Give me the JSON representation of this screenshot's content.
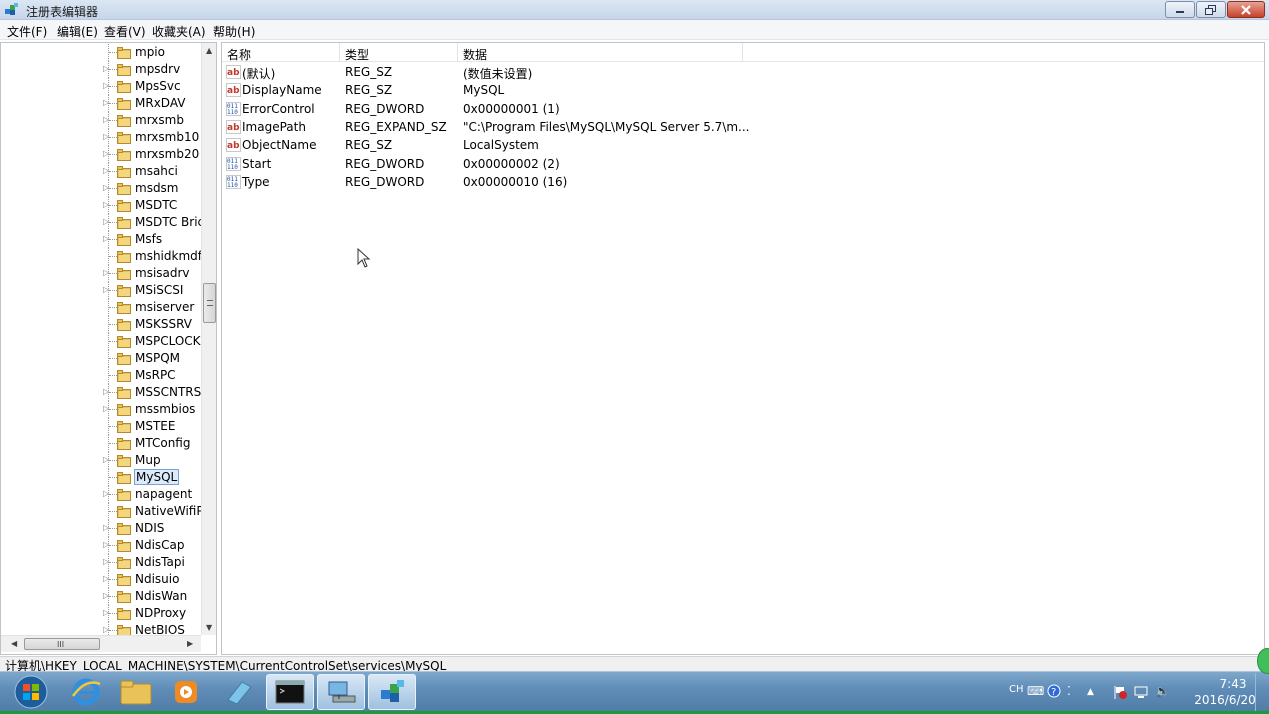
{
  "window": {
    "title": "注册表编辑器"
  },
  "menu": [
    "文件(F)",
    "编辑(E)",
    "查看(V)",
    "收藏夹(A)",
    "帮助(H)"
  ],
  "tree": {
    "items": [
      {
        "label": "mpio",
        "expandable": false
      },
      {
        "label": "mpsdrv",
        "expandable": true
      },
      {
        "label": "MpsSvc",
        "expandable": true
      },
      {
        "label": "MRxDAV",
        "expandable": true
      },
      {
        "label": "mrxsmb",
        "expandable": true
      },
      {
        "label": "mrxsmb10",
        "expandable": true
      },
      {
        "label": "mrxsmb20",
        "expandable": true
      },
      {
        "label": "msahci",
        "expandable": true
      },
      {
        "label": "msdsm",
        "expandable": true
      },
      {
        "label": "MSDTC",
        "expandable": true
      },
      {
        "label": "MSDTC Bric",
        "expandable": true
      },
      {
        "label": "Msfs",
        "expandable": true
      },
      {
        "label": "mshidkmdf",
        "expandable": false
      },
      {
        "label": "msisadrv",
        "expandable": true
      },
      {
        "label": "MSiSCSI",
        "expandable": true
      },
      {
        "label": "msiserver",
        "expandable": false
      },
      {
        "label": "MSKSSRV",
        "expandable": false
      },
      {
        "label": "MSPCLOCK",
        "expandable": false
      },
      {
        "label": "MSPQM",
        "expandable": false
      },
      {
        "label": "MsRPC",
        "expandable": false
      },
      {
        "label": "MSSCNTRS",
        "expandable": true
      },
      {
        "label": "mssmbios",
        "expandable": true
      },
      {
        "label": "MSTEE",
        "expandable": false
      },
      {
        "label": "MTConfig",
        "expandable": false
      },
      {
        "label": "Mup",
        "expandable": true
      },
      {
        "label": "MySQL",
        "expandable": false,
        "selected": true
      },
      {
        "label": "napagent",
        "expandable": true
      },
      {
        "label": "NativeWifiP",
        "expandable": false
      },
      {
        "label": "NDIS",
        "expandable": true
      },
      {
        "label": "NdisCap",
        "expandable": true
      },
      {
        "label": "NdisTapi",
        "expandable": true
      },
      {
        "label": "Ndisuio",
        "expandable": true
      },
      {
        "label": "NdisWan",
        "expandable": true
      },
      {
        "label": "NDProxy",
        "expandable": true
      },
      {
        "label": "NetBIOS",
        "expandable": true
      }
    ]
  },
  "list": {
    "columns": [
      "名称",
      "类型",
      "数据"
    ],
    "rows": [
      {
        "icon": "string",
        "name": "(默认)",
        "type": "REG_SZ",
        "data": "(数值未设置)"
      },
      {
        "icon": "string",
        "name": "DisplayName",
        "type": "REG_SZ",
        "data": "MySQL"
      },
      {
        "icon": "binary",
        "name": "ErrorControl",
        "type": "REG_DWORD",
        "data": "0x00000001 (1)"
      },
      {
        "icon": "string",
        "name": "ImagePath",
        "type": "REG_EXPAND_SZ",
        "data": "\"C:\\Program Files\\MySQL\\MySQL Server 5.7\\m..."
      },
      {
        "icon": "string",
        "name": "ObjectName",
        "type": "REG_SZ",
        "data": "LocalSystem"
      },
      {
        "icon": "binary",
        "name": "Start",
        "type": "REG_DWORD",
        "data": "0x00000002 (2)"
      },
      {
        "icon": "binary",
        "name": "Type",
        "type": "REG_DWORD",
        "data": "0x00000010 (16)"
      }
    ]
  },
  "status": {
    "path": "计算机\\HKEY_LOCAL_MACHINE\\SYSTEM\\CurrentControlSet\\services\\MySQL"
  },
  "taskbar": {
    "apps": [
      "start-orb",
      "internet-explorer",
      "file-explorer",
      "media-player",
      "app",
      "command-prompt",
      "network-app",
      "registry-editor"
    ],
    "tray": {
      "ime": "CH",
      "time": "7:43",
      "date": "2016/6/20"
    }
  },
  "colors": {
    "selection": "#dcebfc",
    "taskbar": "#5f8db7",
    "titlebar": "#c6d6ea"
  }
}
